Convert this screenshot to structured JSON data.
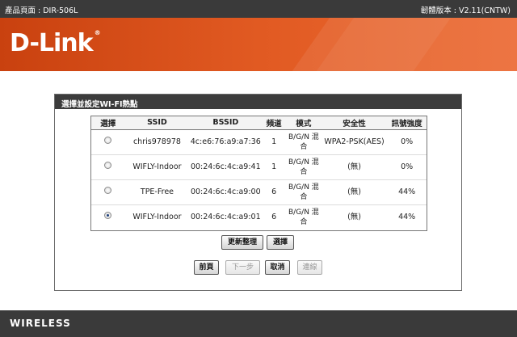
{
  "topbar": {
    "product_page": "產品頁面 : DIR-506L",
    "firmware": "韌體版本 : V2.11(CNTW)"
  },
  "brand": {
    "logo_text": "D-Link",
    "logo_reg": "®"
  },
  "panel": {
    "title": "選擇並設定WI-FI熱點",
    "columns": [
      "選擇",
      "SSID",
      "BSSID",
      "頻道",
      "模式",
      "安全性",
      "訊號強度"
    ],
    "rows": [
      {
        "selected": false,
        "ssid": "chris978978",
        "bssid": "4c:e6:76:a9:a7:36",
        "channel": "1",
        "mode_line1": "B/G/N 混",
        "mode_line2": "合",
        "security": "WPA2-PSK(AES)",
        "signal": "0%"
      },
      {
        "selected": false,
        "ssid": "WIFLY-Indoor",
        "bssid": "00:24:6c:4c:a9:41",
        "channel": "1",
        "mode_line1": "B/G/N 混",
        "mode_line2": "合",
        "security": "(無)",
        "signal": "0%"
      },
      {
        "selected": false,
        "ssid": "TPE-Free",
        "bssid": "00:24:6c:4c:a9:00",
        "channel": "6",
        "mode_line1": "B/G/N 混",
        "mode_line2": "合",
        "security": "(無)",
        "signal": "44%"
      },
      {
        "selected": true,
        "ssid": "WIFLY-Indoor",
        "bssid": "00:24:6c:4c:a9:01",
        "channel": "6",
        "mode_line1": "B/G/N 混",
        "mode_line2": "合",
        "security": "(無)",
        "signal": "44%"
      }
    ],
    "buttons": {
      "refresh": "更新整理",
      "select": "選擇",
      "prev": "前頁",
      "next": "下一步",
      "cancel": "取消",
      "connect": "連線"
    }
  },
  "footer": {
    "label": "WIRELESS"
  },
  "colors": {
    "brand_orange": "#e15a22",
    "dark_bar": "#3a3a3a"
  }
}
